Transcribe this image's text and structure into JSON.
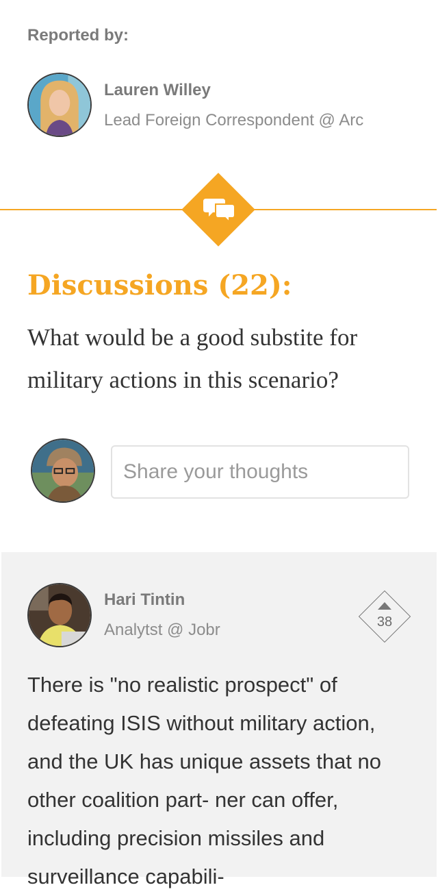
{
  "reported_by": {
    "label": "Reported by:",
    "name": "Lauren Willey",
    "role": "Lead Foreign Correspondent @ Arc",
    "avatar_icon": "reporter-avatar-photo"
  },
  "divider": {
    "icon": "chat-bubbles-icon",
    "accent_color": "#f5a623"
  },
  "discussions": {
    "title": "Discussions (22):",
    "question": "What would be a good substite for military actions in this scenario?"
  },
  "composer": {
    "avatar_icon": "current-user-avatar-photo",
    "placeholder": "Share your thoughts"
  },
  "comments": [
    {
      "name": "Hari Tintin",
      "role": "Analytst @ Jobr",
      "votes": "38",
      "body": "There is \"no realistic prospect\" of defeating ISIS without military action, and the UK has unique assets that no other coalition part- ner can offer, including precision missiles and surveillance capabili-"
    }
  ]
}
